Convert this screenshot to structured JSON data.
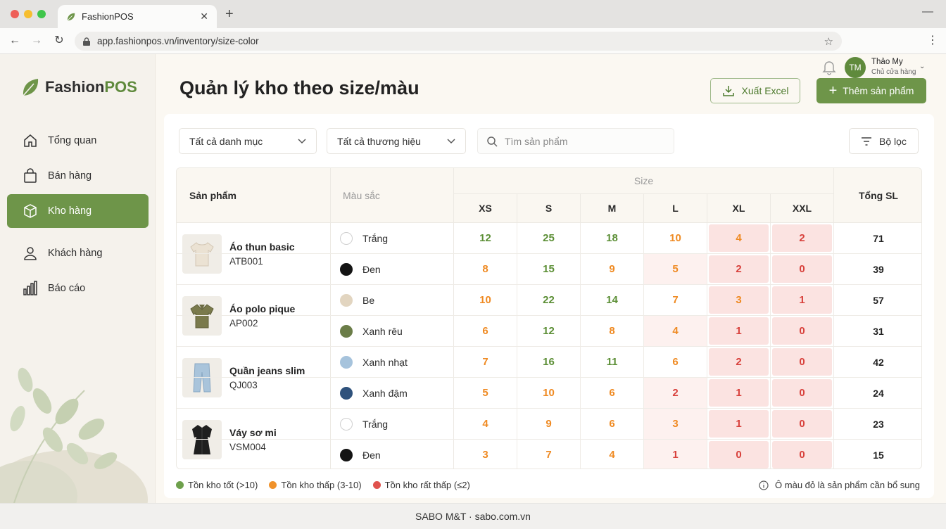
{
  "browser": {
    "tab_title": "FashionPOS",
    "url": "app.fashionpos.vn/inventory/size-color"
  },
  "brand": {
    "name_part1": "Fashion",
    "name_part2": "POS"
  },
  "sidebar": {
    "items": [
      {
        "label": "Tổng quan",
        "icon": "home-icon"
      },
      {
        "label": "Bán hàng",
        "icon": "shopping-bag-icon"
      },
      {
        "label": "Kho hàng",
        "icon": "box-icon",
        "active": true
      },
      {
        "label": "Khách hàng",
        "icon": "user-icon"
      },
      {
        "label": "Báo cáo",
        "icon": "bar-chart-icon"
      }
    ]
  },
  "header": {
    "title": "Quản lý kho theo size/màu",
    "export_label": "Xuất Excel",
    "add_label": "Thêm sản phẩm",
    "user": {
      "initials": "TM",
      "name": "Thảo My",
      "role": "Chủ cửa hàng"
    }
  },
  "filters": {
    "category": "Tất cả danh mục",
    "brand": "Tất cả thương hiệu",
    "search_placeholder": "Tìm sản phẩm",
    "filter_label": "Bộ lọc"
  },
  "table": {
    "col_product": "Sản phẩm",
    "col_color": "Màu sắc",
    "col_size_group": "Size",
    "sizes": [
      "XS",
      "S",
      "M",
      "L",
      "XL",
      "XXL"
    ],
    "col_total": "Tổng SL",
    "products": [
      {
        "name": "Áo thun basic",
        "code": "ATB001",
        "thumb": "tshirt",
        "variants": [
          {
            "color": "Trắng",
            "swatch": "#ffffff",
            "qty": [
              12,
              25,
              18,
              10,
              4,
              2
            ],
            "total": 71
          },
          {
            "color": "Đen",
            "swatch": "#141414",
            "qty": [
              8,
              15,
              9,
              5,
              2,
              0
            ],
            "total": 39
          }
        ]
      },
      {
        "name": "Áo polo pique",
        "code": "AP002",
        "thumb": "polo",
        "variants": [
          {
            "color": "Be",
            "swatch": "#e2d5c0",
            "qty": [
              10,
              22,
              14,
              7,
              3,
              1
            ],
            "total": 57
          },
          {
            "color": "Xanh rêu",
            "swatch": "#6b7d48",
            "qty": [
              6,
              12,
              8,
              4,
              1,
              0
            ],
            "total": 31
          }
        ]
      },
      {
        "name": "Quần jeans slim",
        "code": "QJ003",
        "thumb": "jeans",
        "variants": [
          {
            "color": "Xanh nhạt",
            "swatch": "#a6c3dc",
            "qty": [
              7,
              16,
              11,
              6,
              2,
              0
            ],
            "total": 42
          },
          {
            "color": "Xanh đậm",
            "swatch": "#2f527c",
            "qty": [
              5,
              10,
              6,
              2,
              1,
              0
            ],
            "total": 24
          }
        ]
      },
      {
        "name": "Váy sơ mi",
        "code": "VSM004",
        "thumb": "dress",
        "variants": [
          {
            "color": "Trắng",
            "swatch": "#ffffff",
            "qty": [
              4,
              9,
              6,
              3,
              1,
              0
            ],
            "total": 23
          },
          {
            "color": "Đen",
            "swatch": "#141414",
            "qty": [
              3,
              7,
              4,
              1,
              0,
              0
            ],
            "total": 15
          }
        ]
      }
    ]
  },
  "legend": [
    {
      "label": "Tồn kho tốt (>10)",
      "color": "#6ea04c"
    },
    {
      "label": "Tồn kho thấp (3-10)",
      "color": "#f0922b"
    },
    {
      "label": "Tồn kho rất thấp (≤2)",
      "color": "#e0524d"
    }
  ],
  "note": "Ô màu đỏ là sản phẩm cần bổ sung",
  "footer": "SABO M&T · sabo.com.vn",
  "colors": {
    "accent": "#6e9549",
    "good": "#5c8f36",
    "low": "#ef8a22",
    "critical": "#d8413c",
    "critical_bg": "#fbe3e1",
    "warn_bg": "#fdf1ef"
  }
}
